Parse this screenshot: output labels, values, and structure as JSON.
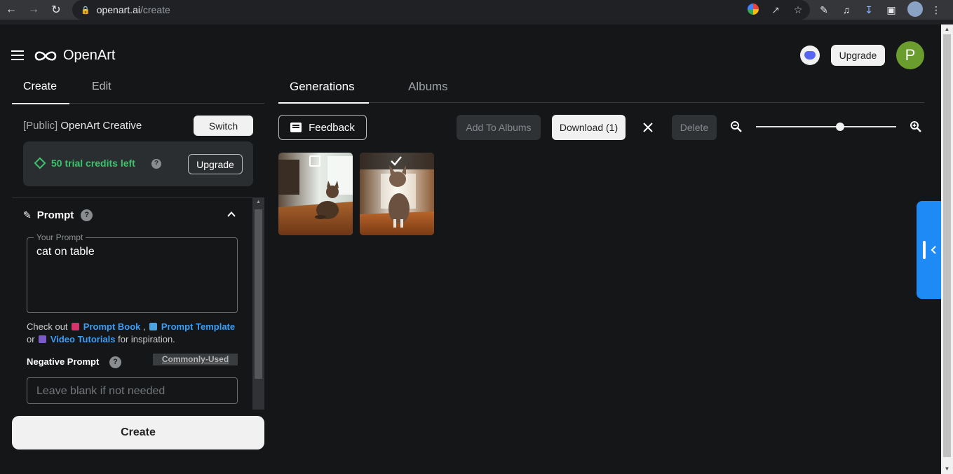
{
  "browser": {
    "url_host": "openart.ai",
    "url_path": "/create"
  },
  "header": {
    "brand": "OpenArt",
    "upgrade_label": "Upgrade",
    "avatar_letter": "P"
  },
  "left_panel": {
    "tabs": [
      {
        "label": "Create",
        "active": true
      },
      {
        "label": "Edit",
        "active": false
      }
    ],
    "model_prefix": "[Public]",
    "model_name": "OpenArt Creative",
    "switch_label": "Switch",
    "credits_text": "50 trial credits left",
    "credits_upgrade_label": "Upgrade",
    "prompt": {
      "title": "Prompt",
      "field_legend": "Your Prompt",
      "value": "cat on table",
      "inspire_prefix": "Check out",
      "prompt_book": "Prompt Book",
      "prompt_template": "Prompt Template",
      "or": "or",
      "video_tutorials": "Video Tutorials",
      "inspire_suffix": "for inspiration.",
      "negative_label": "Negative Prompt",
      "commonly_used": "Commonly-Used",
      "negative_placeholder": "Leave blank if not needed"
    },
    "create_label": "Create"
  },
  "main": {
    "tabs": [
      {
        "label": "Generations",
        "active": true
      },
      {
        "label": "Albums",
        "active": false
      }
    ],
    "toolbar": {
      "feedback_label": "Feedback",
      "add_to_albums_label": "Add To Albums",
      "download_label": "Download (1)",
      "delete_label": "Delete",
      "zoom_level": 0.6
    },
    "images": [
      {
        "selected": false
      },
      {
        "selected": true
      }
    ]
  },
  "colors": {
    "accent_green": "#3cc46c",
    "link_blue": "#3b9ef5",
    "side_handle_blue": "#1e8af5",
    "avatar_green": "#6a9c2e"
  }
}
